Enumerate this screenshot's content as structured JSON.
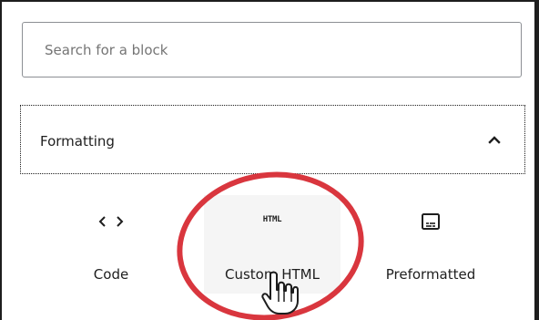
{
  "search": {
    "placeholder": "Search for a block",
    "value": ""
  },
  "panel": {
    "title": "Formatting",
    "toggle_icon": "chevron-up-icon",
    "expanded": true
  },
  "blocks": [
    {
      "label": "Code",
      "icon": "code-brackets-icon"
    },
    {
      "label": "Custom HTML",
      "icon": "html-icon",
      "icon_text": "HTML",
      "hovered": true
    },
    {
      "label": "Preformatted",
      "icon": "preformatted-icon"
    }
  ],
  "annotation": {
    "shape": "ellipse",
    "color": "#d9363e"
  },
  "cursor": {
    "icon": "hand-pointer-icon"
  }
}
